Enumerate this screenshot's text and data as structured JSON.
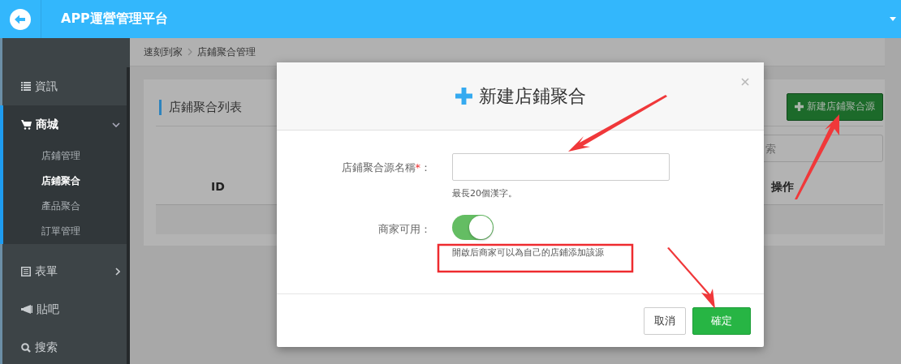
{
  "header": {
    "title": "APP運營管理平台"
  },
  "sidebar": {
    "items": [
      {
        "label": "資訊"
      },
      {
        "label": "商城",
        "expanded": true,
        "children": [
          {
            "label": "店鋪管理",
            "selected": false
          },
          {
            "label": "店鋪聚合",
            "selected": true
          },
          {
            "label": "產品聚合",
            "selected": false
          },
          {
            "label": "訂單管理",
            "selected": false
          }
        ]
      },
      {
        "label": "表單",
        "expanded": false
      },
      {
        "label": "貼吧"
      },
      {
        "label": "搜索"
      }
    ]
  },
  "breadcrumb": [
    "速刻到家",
    "店鋪聚合管理"
  ],
  "card": {
    "title": "店鋪聚合列表",
    "new_button": "新建店鋪聚合源",
    "search": {
      "placeholder": "索"
    },
    "columns": [
      "ID",
      "操作"
    ]
  },
  "modal": {
    "title": "新建店鋪聚合",
    "fields": [
      {
        "kind": "text",
        "label": "店鋪聚合源名稱",
        "required_mark": "*",
        "colon": "：",
        "hint": "最長20個漢字。"
      },
      {
        "kind": "toggle",
        "label": "商家可用",
        "colon": "：",
        "on": true,
        "hint": "開啟后商家可以為自己的店鋪添加該源"
      }
    ],
    "buttons": [
      {
        "kind": "default",
        "label": "取消"
      },
      {
        "kind": "primary",
        "label": "確定"
      }
    ]
  }
}
